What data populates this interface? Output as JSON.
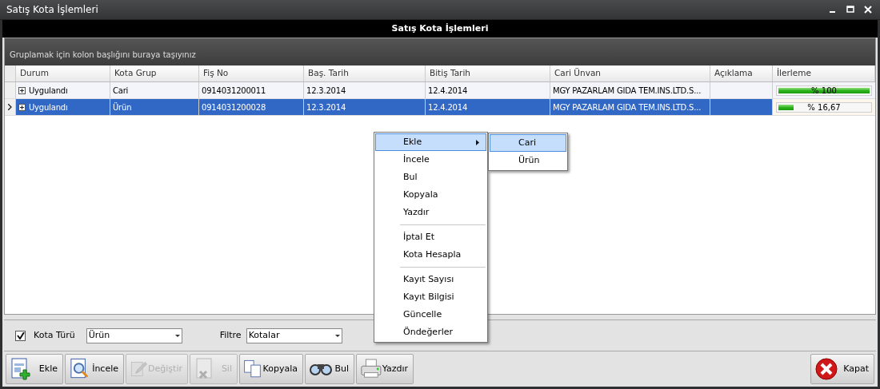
{
  "window": {
    "title": "Satış Kota İşlemleri"
  },
  "panel": {
    "title": "Satış Kota İşlemleri",
    "group_hint": "Gruplamak için kolon başlığını buraya taşıyınız"
  },
  "table": {
    "columns": [
      "Durum",
      "Kota Grup",
      "Fiş No",
      "Baş. Tarih",
      "Bitiş Tarih",
      "Cari Ünvan",
      "Açıklama",
      "İlerleme"
    ],
    "rows": [
      {
        "selected": false,
        "durum": "Uygulandı",
        "kota_grup": "Cari",
        "fis_no": "0914031200011",
        "bas_tarih": "12.3.2014",
        "bitis_tarih": "12.4.2014",
        "cari_unvan": "MGY PAZARLAM GIDA TEM.INS.LTD.S...",
        "ilerleme": "% 100",
        "level": 1
      },
      {
        "selected": true,
        "durum": "Uygulandı",
        "kota_grup": "Ürün",
        "fis_no": "0914031200028",
        "bas_tarih": "12.3.2014",
        "bitis_tarih": "12.4.2014",
        "cari_unvan": "MGY PAZARLAM GIDA TEM.INS.LTD.S...",
        "ilerleme": "% 16,67",
        "level": 0.1667
      }
    ]
  },
  "context_menu": {
    "items": [
      {
        "kind": "item",
        "label": "Ekle",
        "selected": true,
        "submenu": true
      },
      {
        "kind": "item",
        "label": "İncele",
        "selected": false,
        "submenu": false
      },
      {
        "kind": "item",
        "label": "Bul",
        "selected": false,
        "submenu": false
      },
      {
        "kind": "item",
        "label": "Kopyala",
        "selected": false,
        "submenu": false
      },
      {
        "kind": "item",
        "label": "Yazdır",
        "selected": false,
        "submenu": false
      },
      {
        "kind": "separator"
      },
      {
        "kind": "item",
        "label": "İptal Et",
        "selected": false,
        "submenu": false
      },
      {
        "kind": "item",
        "label": "Kota Hesapla",
        "selected": false,
        "submenu": false
      },
      {
        "kind": "separator"
      },
      {
        "kind": "item",
        "label": "Kayıt Sayısı",
        "selected": false,
        "submenu": false
      },
      {
        "kind": "item",
        "label": "Kayıt Bilgisi",
        "selected": false,
        "submenu": false
      },
      {
        "kind": "item",
        "label": "Güncelle",
        "selected": false,
        "submenu": false
      },
      {
        "kind": "item",
        "label": "Öndeğerler",
        "selected": false,
        "submenu": false
      }
    ],
    "submenu": [
      {
        "label": "Cari",
        "selected": true
      },
      {
        "label": "Ürün",
        "selected": false
      }
    ]
  },
  "filters": {
    "kota_turu": {
      "label": "Kota Türü",
      "checked": true,
      "value": "Ürün"
    },
    "filtre": {
      "label": "Filtre",
      "value": "Kotalar"
    }
  },
  "toolbar": [
    {
      "kind": "add",
      "label": "Ekle",
      "disabled": false
    },
    {
      "kind": "inspect",
      "label": "İncele",
      "disabled": false
    },
    {
      "kind": "edit",
      "label": "Değiştir",
      "disabled": true
    },
    {
      "kind": "delete",
      "label": "Sil",
      "disabled": true
    },
    {
      "kind": "copy",
      "label": "Kopyala",
      "disabled": false
    },
    {
      "kind": "find",
      "label": "Bul",
      "disabled": false
    },
    {
      "kind": "print",
      "label": "Yazdır",
      "disabled": false
    },
    {
      "kind": "close",
      "label": "Kapat",
      "disabled": false
    }
  ]
}
